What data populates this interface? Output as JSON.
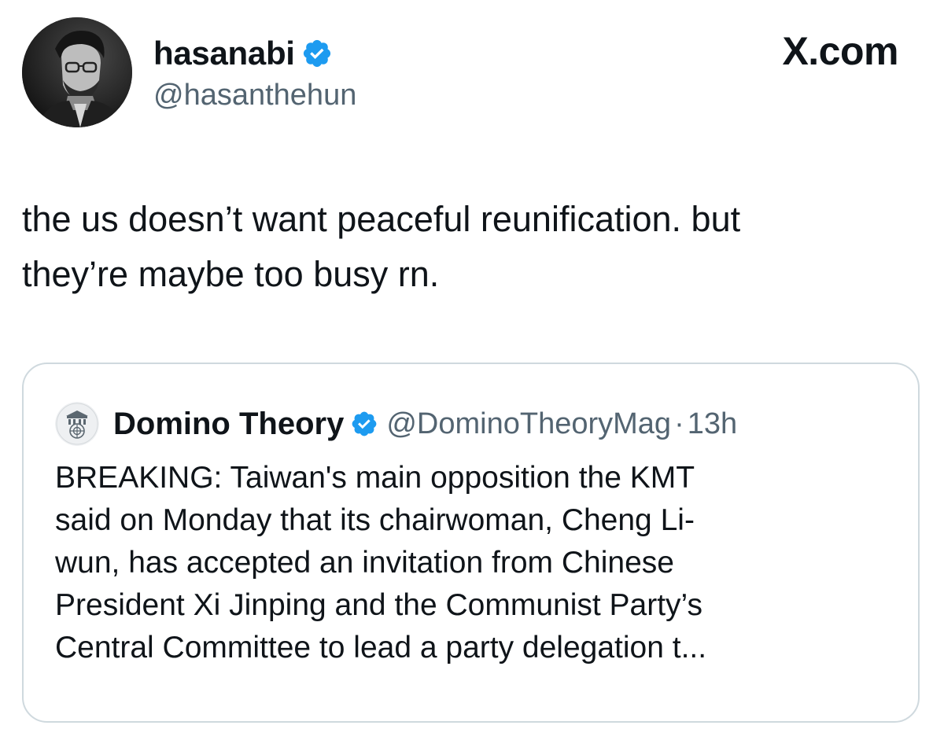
{
  "site": {
    "logo": "X.com"
  },
  "author": {
    "name": "hasanabi",
    "handle": "@hasanthehun",
    "verified": true,
    "badge_color": "#1d9bf0"
  },
  "tweet": {
    "lines": [
      "the us doesn’t want peaceful reunification. but",
      "they’re maybe too busy rn."
    ]
  },
  "quote": {
    "name": "Domino Theory",
    "handle": "@DominoTheoryMag",
    "separator": "·",
    "time": "13h",
    "verified": true,
    "lines": [
      "BREAKING: Taiwan's main opposition the KMT",
      "said on Monday that its chairwoman, Cheng Li-",
      "wun, has accepted an invitation from Chinese",
      "President Xi Jinping and the Communist Party’s",
      "Central Committee to lead a party delegation t..."
    ]
  },
  "colors": {
    "text": "#0f1419",
    "secondary": "#536471",
    "border": "#cfd9de",
    "verified": "#1d9bf0"
  }
}
